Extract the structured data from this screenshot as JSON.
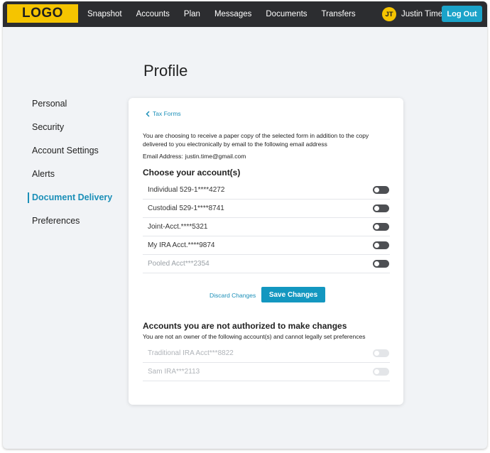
{
  "header": {
    "logo": "LOGO",
    "nav": [
      "Snapshot",
      "Accounts",
      "Plan",
      "Messages",
      "Documents",
      "Transfers"
    ],
    "user_initials": "JT",
    "user_name": "Justin Time",
    "logout_label": "Log Out"
  },
  "page": {
    "title": "Profile"
  },
  "sidebar": {
    "items": [
      {
        "label": "Personal"
      },
      {
        "label": "Security"
      },
      {
        "label": "Account Settings"
      },
      {
        "label": "Alerts"
      },
      {
        "label": "Document Delivery"
      },
      {
        "label": "Preferences"
      }
    ],
    "active": "Document Delivery"
  },
  "card": {
    "back_label": "Tax Forms",
    "description": "You are choosing to receive a paper copy of the selected form in addition to the copy delivered to you electronically by email to the following email address",
    "email_label": "Email Address:",
    "email_value": "justin.time@gmail.com",
    "choose_title": "Choose your account(s)",
    "accounts": [
      {
        "label": "Individual 529-1****4272"
      },
      {
        "label": "Custodial 529-1****8741"
      },
      {
        "label": "Joint-Acct.****5321"
      },
      {
        "label": "My IRA Acct.****9874"
      },
      {
        "label": "Pooled Acct***2354"
      }
    ],
    "discard_label": "Discard Changes",
    "save_label": "Save Changes",
    "unauth_title": "Accounts you are not authorized to make changes",
    "unauth_sub": "You are not an owner of the following account(s) and cannot legally set preferences",
    "unauth_accounts": [
      {
        "label": "Traditional IRA Acct***8822"
      },
      {
        "label": "Sam IRA***2113"
      }
    ]
  },
  "colors": {
    "accent": "#1b8fb8",
    "brand_yellow": "#f5c400",
    "topbar": "#2c2d30",
    "save_button": "#1397c0"
  }
}
